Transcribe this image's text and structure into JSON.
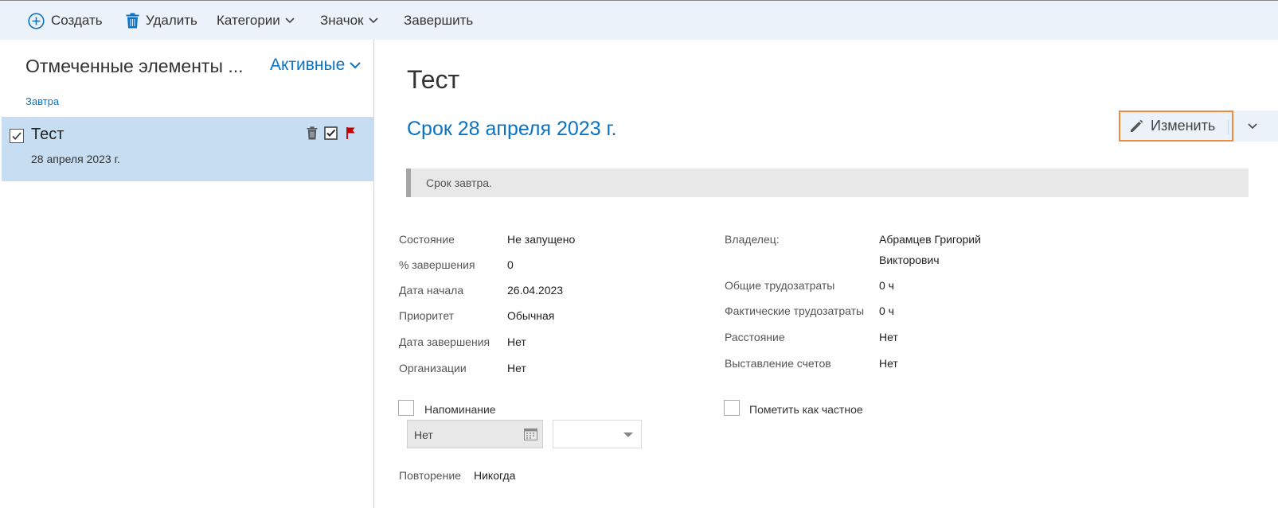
{
  "toolbar": {
    "create": "Создать",
    "delete": "Удалить",
    "categories": "Категории",
    "flag": "Значок",
    "complete": "Завершить"
  },
  "left": {
    "title": "Отмеченные элементы ...",
    "filter": "Активные",
    "group": "Завтра",
    "item": {
      "title": "Тест",
      "date": "28 апреля 2023 г."
    }
  },
  "detail": {
    "title": "Тест",
    "due": "Срок 28 апреля 2023 г.",
    "edit_label": "Изменить",
    "info": "Срок завтра.",
    "left_fields": [
      {
        "label": "Состояние",
        "value": "Не запущено"
      },
      {
        "label": "% завершения",
        "value": "0"
      },
      {
        "label": "Дата начала",
        "value": "26.04.2023"
      },
      {
        "label": "Приоритет",
        "value": "Обычная"
      },
      {
        "label": "Дата завершения",
        "value": "Нет"
      },
      {
        "label": "Организации",
        "value": "Нет"
      }
    ],
    "owner_label": "Владелец:",
    "owner_line1": "Абрамцев Григорий",
    "owner_line2": "Викторович",
    "right_fields": [
      {
        "label": "Общие трудозатраты",
        "value": "0 ч"
      },
      {
        "label": "Фактические трудозатраты",
        "value": "0 ч"
      },
      {
        "label": "Расстояние",
        "value": "Нет"
      },
      {
        "label": "Выставление счетов",
        "value": "Нет"
      }
    ],
    "reminder_label": "Напоминание",
    "reminder_date": "Нет",
    "private_label": "Пометить как частное",
    "recurrence_label": "Повторение",
    "recurrence_value": "Никогда"
  },
  "colors": {
    "accent": "#0a73c4",
    "toolbar_bg": "#ecf2fa",
    "selected_bg": "#c7def2",
    "highlight_border": "#f08a3c",
    "flag": "#c00000"
  }
}
